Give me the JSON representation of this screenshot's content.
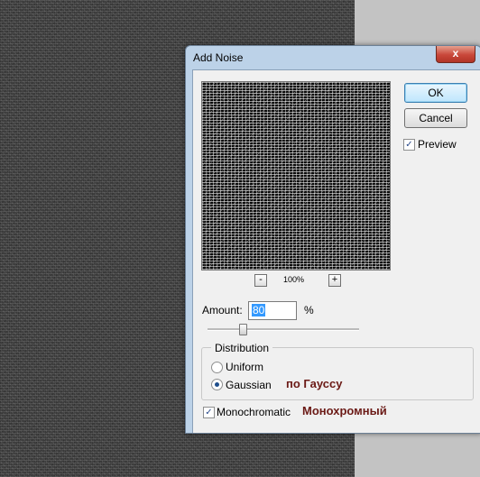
{
  "dialog": {
    "title": "Add Noise",
    "close_glyph": "x"
  },
  "buttons": {
    "ok": "OK",
    "cancel": "Cancel"
  },
  "preview": {
    "label": "Preview",
    "checked": true,
    "check_glyph": "✓",
    "zoom_level": "100%",
    "zoom_out": "-",
    "zoom_in": "+"
  },
  "amount": {
    "label": "Amount:",
    "value": "80",
    "unit": "%"
  },
  "distribution": {
    "legend": "Distribution",
    "options": [
      {
        "label": "Uniform",
        "selected": false
      },
      {
        "label": "Gaussian",
        "selected": true
      }
    ],
    "gaussian_annotation": "по Гауссу"
  },
  "monochromatic": {
    "label": "Monochromatic",
    "checked": true,
    "check_glyph": "✓",
    "annotation": "Монохромный"
  },
  "colors": {
    "annotation": "#6b1a16",
    "close_button": "#c9473a"
  }
}
